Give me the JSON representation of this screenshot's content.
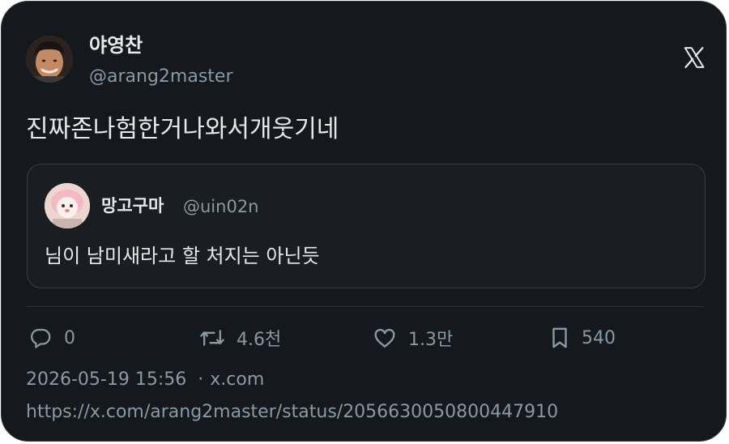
{
  "post": {
    "author": {
      "display_name": "야영찬",
      "handle": "@arang2master"
    },
    "text": "진짜존나험한거나와서개웃기네",
    "quoted": {
      "display_name": "망고구마",
      "handle": "@uin02n",
      "text": "님이 남미새라고 할 처지는 아닌듯"
    },
    "stats": {
      "replies": "0",
      "reposts": "4.6천",
      "likes": "1.3만",
      "bookmarks": "540"
    },
    "timestamp": "2026-05-19 15:56",
    "separator": "·",
    "source": "x.com",
    "url": "https://x.com/arang2master/status/2056630050800447910"
  },
  "icons": {
    "brand": "x-logo-icon",
    "reply": "reply-icon",
    "repost": "repost-icon",
    "like": "heart-icon",
    "bookmark": "bookmark-icon"
  },
  "colors": {
    "background": "#15181c",
    "text_primary": "#e7e9ea",
    "text_secondary": "#8b98a5",
    "border": "#2f3336"
  }
}
